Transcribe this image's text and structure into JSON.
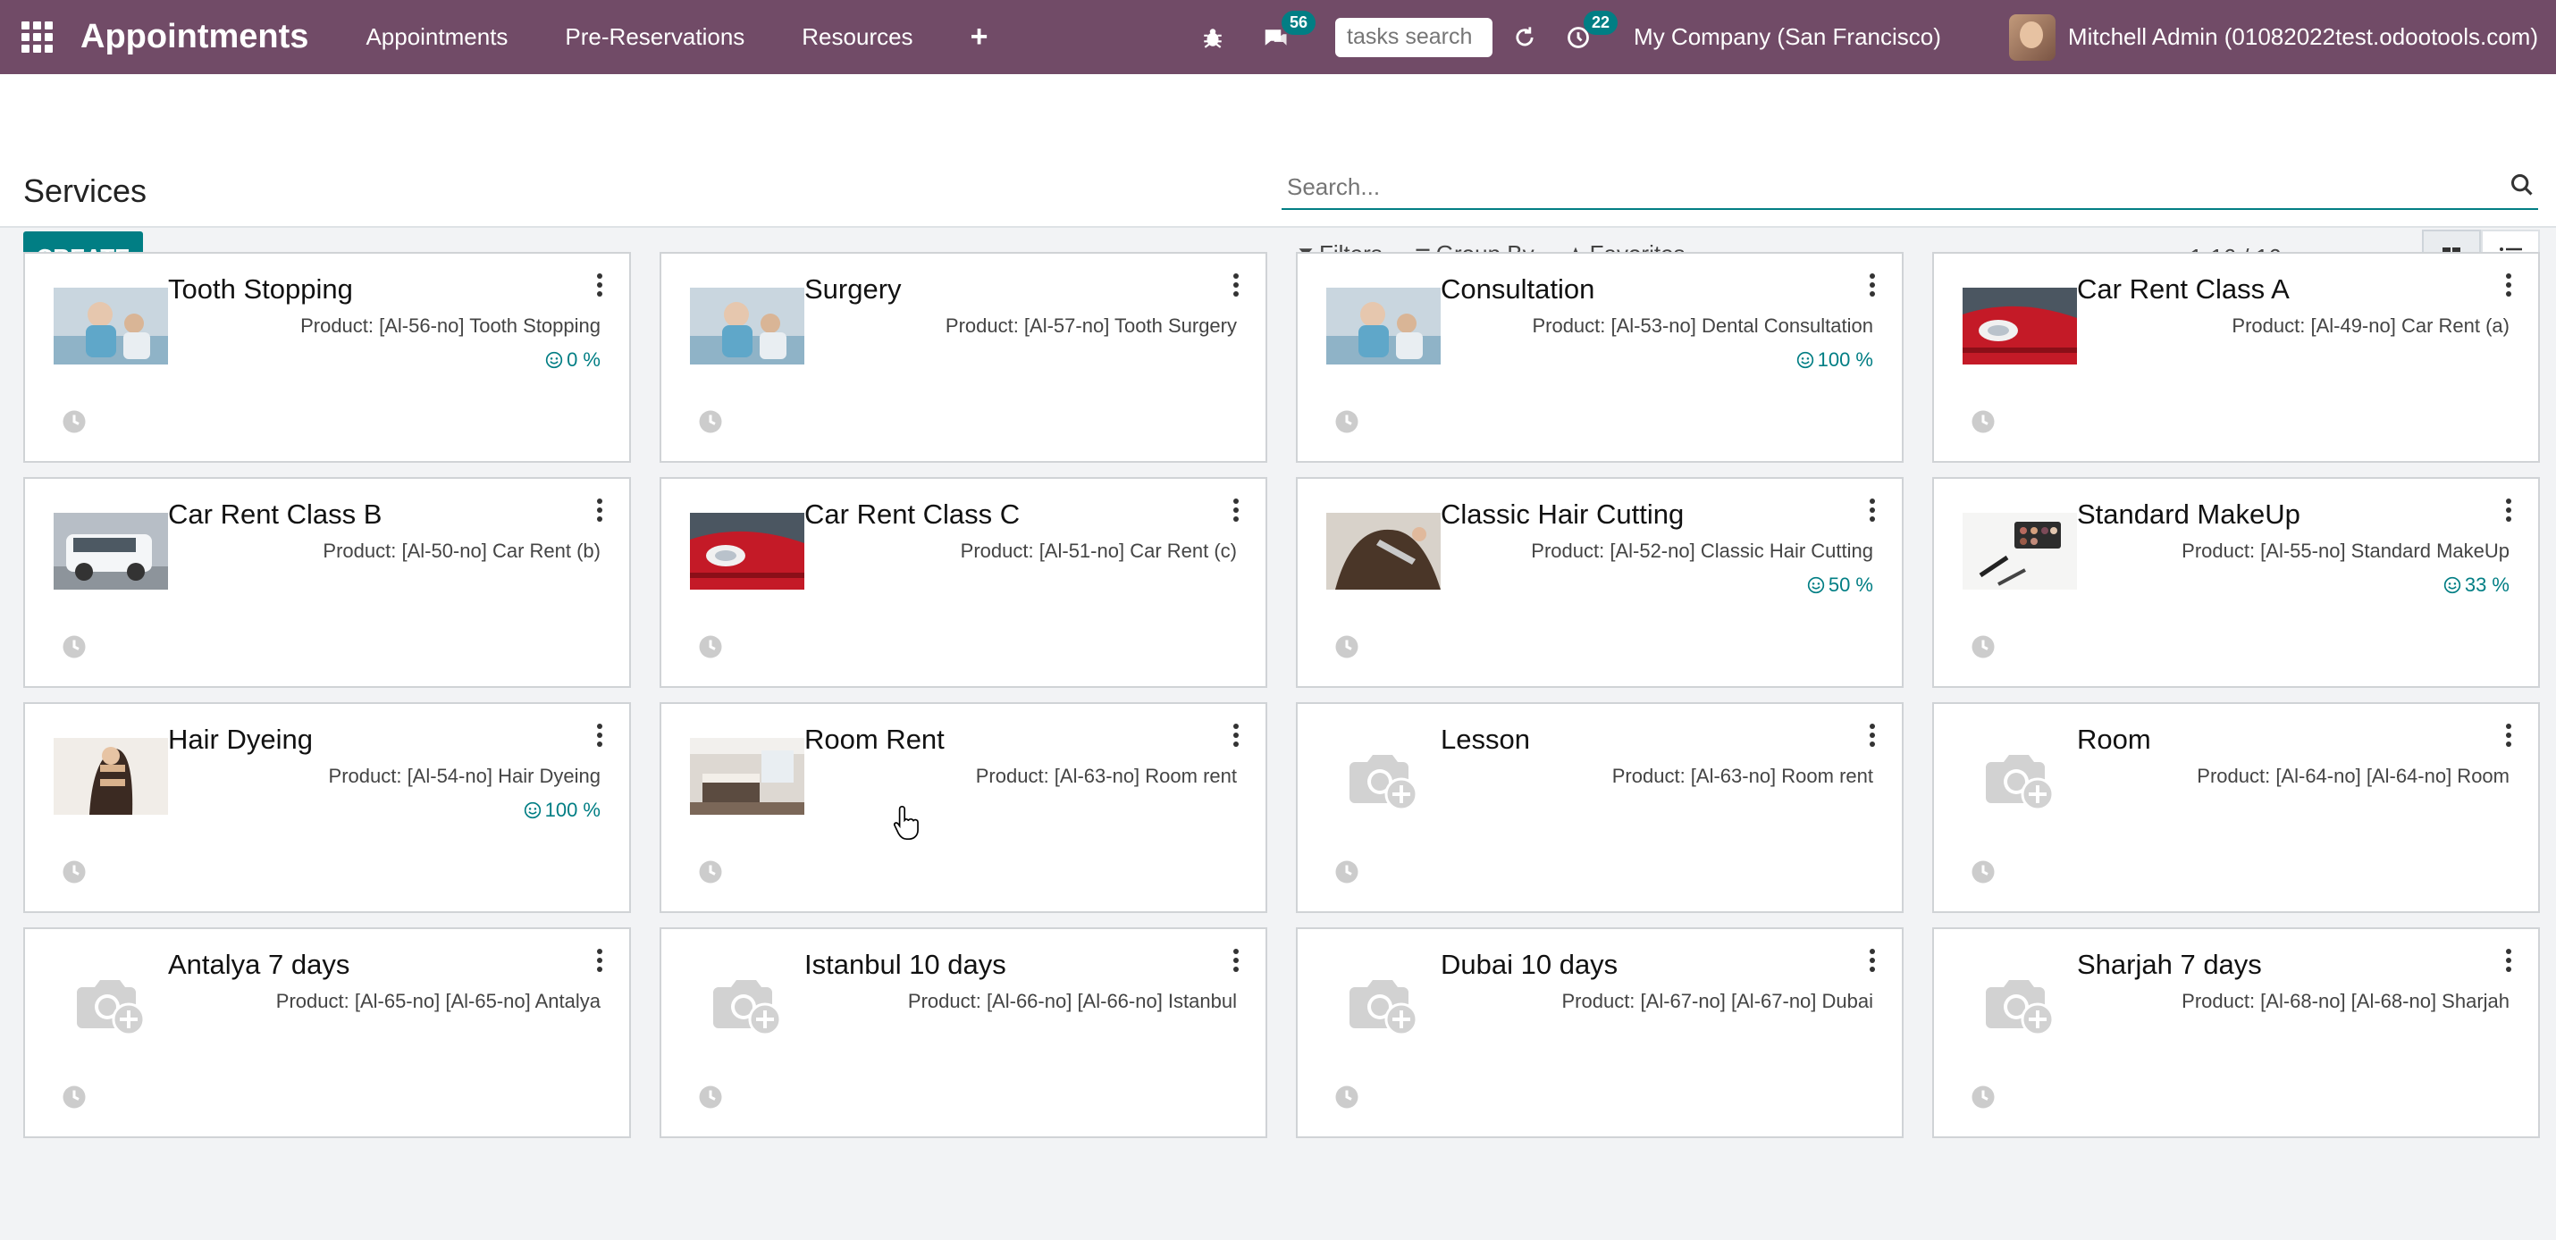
{
  "navbar": {
    "brand": "Appointments",
    "menu": [
      "Appointments",
      "Pre-Reservations",
      "Resources"
    ],
    "plus": "+",
    "chat_count": "56",
    "task_search_placeholder": "tasks search",
    "activity_count": "22",
    "company": "My Company (San Francisco)",
    "user": "Mitchell Admin (01082022test.odootools.com)"
  },
  "control": {
    "title": "Services",
    "create_label": "CREATE",
    "search_placeholder": "Search...",
    "filters_label": "Filters",
    "group_by_label": "Group By",
    "favorites_label": "Favorites",
    "pager": "1-16 / 16"
  },
  "cards": [
    {
      "title": "Tooth Stopping",
      "product": "Product: [Al-56-no] Tooth Stopping",
      "rating": "0 %",
      "image": "dental-photo"
    },
    {
      "title": "Surgery",
      "product": "Product: [Al-57-no] Tooth Surgery",
      "rating": "",
      "image": "dental-photo"
    },
    {
      "title": "Consultation",
      "product": "Product: [Al-53-no] Dental Consultation",
      "rating": "100 %",
      "image": "dental-photo"
    },
    {
      "title": "Car Rent Class A",
      "product": "Product: [Al-49-no] Car Rent (a)",
      "rating": "",
      "image": "car-red-photo"
    },
    {
      "title": "Car Rent Class B",
      "product": "Product: [Al-50-no] Car Rent (b)",
      "rating": "",
      "image": "car-white-photo"
    },
    {
      "title": "Car Rent Class C",
      "product": "Product: [Al-51-no] Car Rent (c)",
      "rating": "",
      "image": "car-red-photo"
    },
    {
      "title": "Classic Hair Cutting",
      "product": "Product: [Al-52-no] Classic Hair Cutting",
      "rating": "50 %",
      "image": "hair-photo"
    },
    {
      "title": "Standard MakeUp",
      "product": "Product: [Al-55-no] Standard MakeUp",
      "rating": "33 %",
      "image": "makeup-photo"
    },
    {
      "title": "Hair Dyeing",
      "product": "Product: [Al-54-no] Hair Dyeing",
      "rating": "100 %",
      "image": "hairdye-photo"
    },
    {
      "title": "Room Rent",
      "product": "Product: [Al-63-no] Room rent",
      "rating": "",
      "image": "room-photo"
    },
    {
      "title": "Lesson",
      "product": "Product: [Al-63-no] Room rent",
      "rating": "",
      "image": "placeholder"
    },
    {
      "title": "Room",
      "product": "Product: [Al-64-no] [Al-64-no] Room",
      "rating": "",
      "image": "placeholder"
    },
    {
      "title": "Antalya 7 days",
      "product": "Product: [Al-65-no] [Al-65-no] Antalya",
      "rating": "",
      "image": "placeholder"
    },
    {
      "title": "Istanbul 10 days",
      "product": "Product: [Al-66-no] [Al-66-no] Istanbul",
      "rating": "",
      "image": "placeholder"
    },
    {
      "title": "Dubai 10 days",
      "product": "Product: [Al-67-no] [Al-67-no] Dubai",
      "rating": "",
      "image": "placeholder"
    },
    {
      "title": "Sharjah 7 days",
      "product": "Product: [Al-68-no] [Al-68-no] Sharjah",
      "rating": "",
      "image": "placeholder"
    }
  ],
  "colors": {
    "navbar": "#714b67",
    "accent": "#017e84"
  }
}
